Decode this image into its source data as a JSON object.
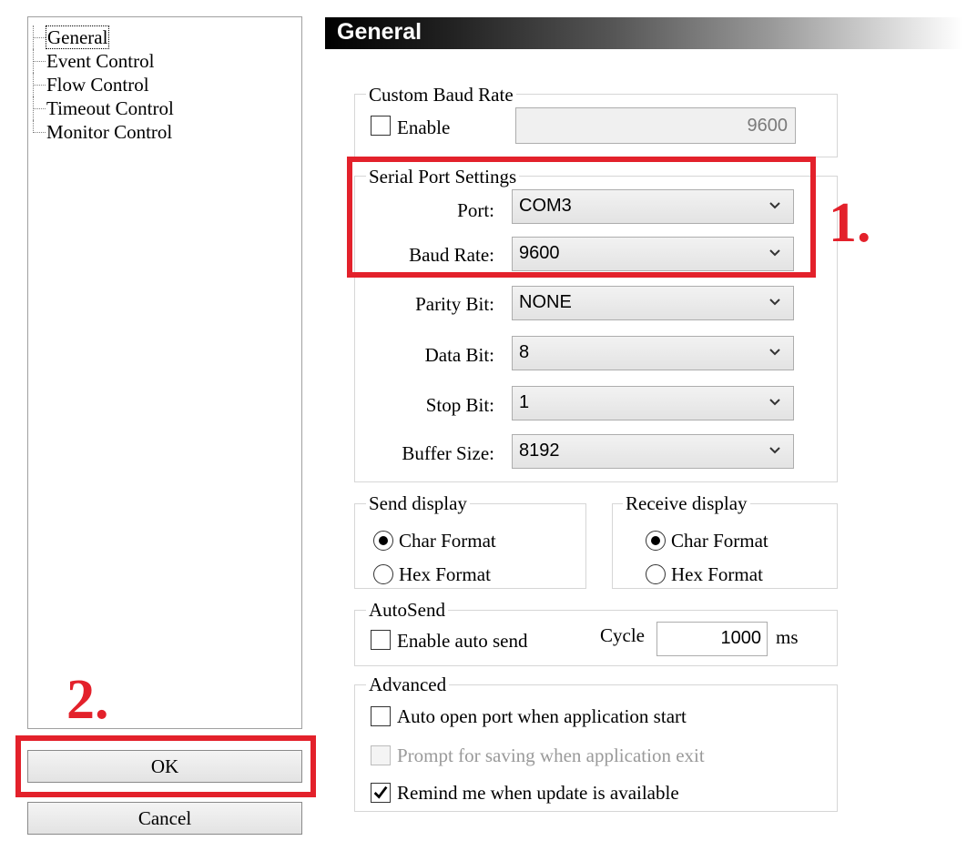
{
  "tree": {
    "items": [
      {
        "label": "General",
        "selected": true
      },
      {
        "label": "Event Control"
      },
      {
        "label": "Flow Control"
      },
      {
        "label": "Timeout Control"
      },
      {
        "label": "Monitor Control"
      }
    ]
  },
  "buttons": {
    "ok": "OK",
    "cancel": "Cancel"
  },
  "header": {
    "title": "General"
  },
  "custom_baud": {
    "group_label": "Custom Baud Rate",
    "enable_label": "Enable",
    "enabled": false,
    "value": "9600"
  },
  "serial": {
    "group_label": "Serial Port Settings",
    "port_label": "Port:",
    "port_value": "COM3",
    "baud_label": "Baud Rate:",
    "baud_value": "9600",
    "parity_label": "Parity Bit:",
    "parity_value": "NONE",
    "data_label": "Data Bit:",
    "data_value": "8",
    "stop_label": "Stop Bit:",
    "stop_value": "1",
    "buffer_label": "Buffer Size:",
    "buffer_value": "8192"
  },
  "send_display": {
    "group_label": "Send display",
    "char_label": "Char Format",
    "hex_label": "Hex  Format",
    "selected": "char"
  },
  "receive_display": {
    "group_label": "Receive display",
    "char_label": "Char Format",
    "hex_label": "Hex  Format",
    "selected": "char"
  },
  "autosend": {
    "group_label": "AutoSend",
    "enable_label": "Enable auto send",
    "enabled": false,
    "cycle_label": "Cycle",
    "cycle_value": "1000",
    "unit": "ms"
  },
  "advanced": {
    "group_label": "Advanced",
    "auto_open_label": "Auto open port when application start",
    "auto_open_checked": false,
    "prompt_save_label": "Prompt for saving when application exit",
    "prompt_save_checked": false,
    "prompt_save_disabled": true,
    "remind_label": "Remind me when update is available",
    "remind_checked": true
  },
  "annotations": {
    "step1": "1.",
    "step2": "2.",
    "color": "#e3212b"
  }
}
